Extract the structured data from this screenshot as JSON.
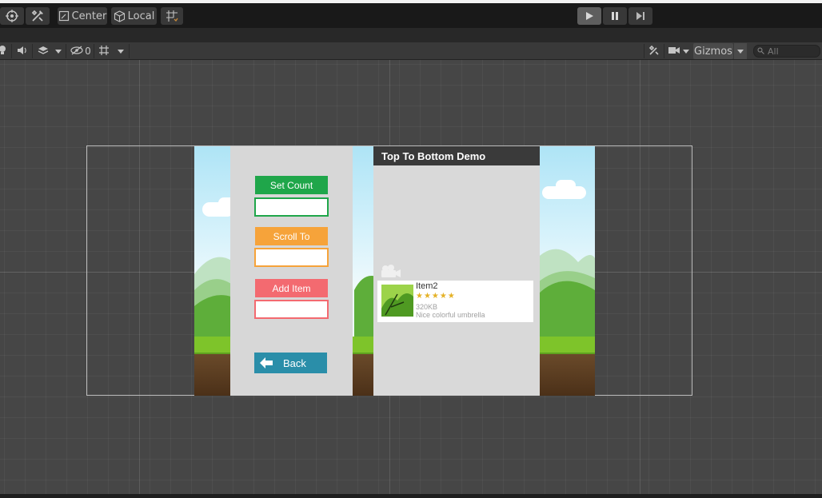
{
  "toolbar": {
    "pivot_label": "Center",
    "space_label": "Local",
    "pivot_icon": "pivot-icon",
    "space_icon": "cube-icon"
  },
  "scene_bar": {
    "gizmos_label": "Gizmos",
    "hidden_count": "0",
    "search_placeholder": "All"
  },
  "game_ui": {
    "buttons": {
      "set_count": "Set Count",
      "scroll_to": "Scroll To",
      "add_item": "Add Item",
      "back": "Back"
    },
    "colors": {
      "set_count": "#1fa64a",
      "scroll_to": "#f6a33a",
      "add_item": "#f36a70",
      "back": "#2a8ea9"
    },
    "list_title": "Top To Bottom Demo",
    "item": {
      "name": "Item2",
      "stars": "★★★★★",
      "rating": 5,
      "size": "320KB",
      "description": "Nice colorful umbrella"
    }
  }
}
